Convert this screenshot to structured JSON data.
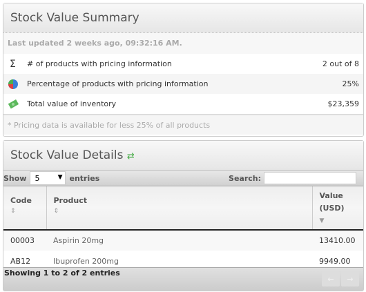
{
  "summary": {
    "title": "Stock Value Summary",
    "last_updated": "Last updated 2 weeks ago, 09:32:16 AM.",
    "rows": [
      {
        "icon": "sigma-icon",
        "label": "# of products with pricing information",
        "value": "2 out of 8"
      },
      {
        "icon": "pie-chart-icon",
        "label": "Percentage of products with pricing information",
        "value": "25%"
      },
      {
        "icon": "money-icon",
        "label": "Total value of inventory",
        "value": "$23,359"
      }
    ],
    "footnote": "* Pricing data is available for less 25% of all products"
  },
  "details": {
    "title": "Stock Value Details",
    "show_label": "Show",
    "entries_value": "5",
    "entries_label": "entries",
    "search_label": "Search:",
    "search_value": "",
    "columns": [
      "Code",
      "Product",
      "Value (USD)"
    ],
    "rows": [
      [
        "00003",
        "Aspirin 20mg",
        "13410.00"
      ],
      [
        "AB12",
        "Ibuprofen 200mg",
        "9949.00"
      ]
    ],
    "info": "Showing 1 to 2 of 2 entries",
    "prev": "←",
    "next": "→"
  }
}
